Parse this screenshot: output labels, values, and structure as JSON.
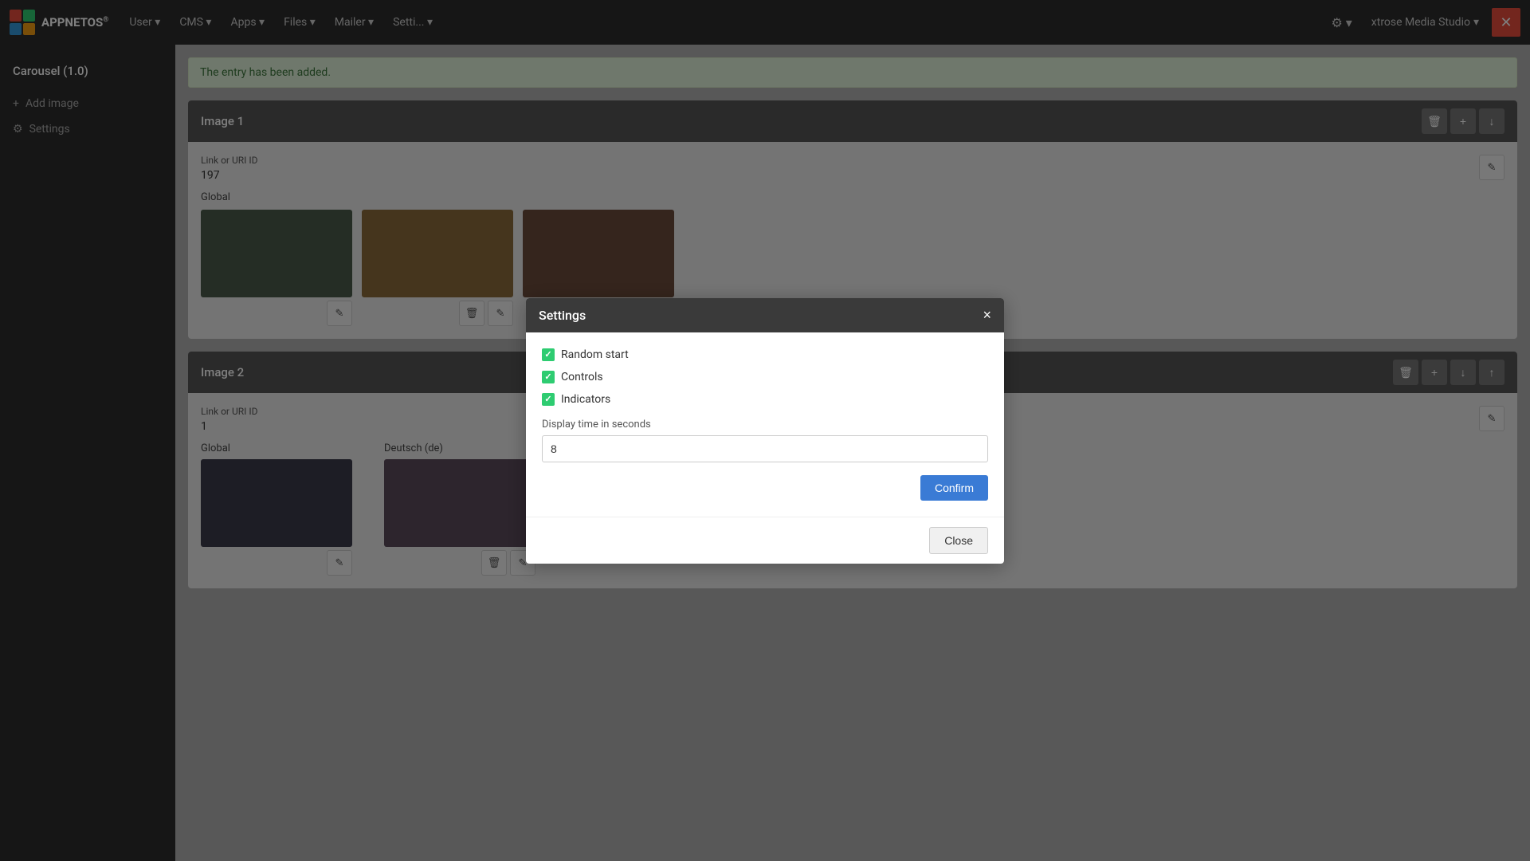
{
  "navbar": {
    "brand": "APPNETOS",
    "brand_sup": "®",
    "nav_items": [
      {
        "label": "User",
        "id": "user"
      },
      {
        "label": "CMS",
        "id": "cms"
      },
      {
        "label": "Apps",
        "id": "apps"
      },
      {
        "label": "Files",
        "id": "files"
      },
      {
        "label": "Mailer",
        "id": "mailer"
      },
      {
        "label": "Setti...",
        "id": "settings"
      }
    ],
    "gear_label": "⚙",
    "studio_label": "xtrose Media Studio",
    "close_icon": "✕"
  },
  "sidebar": {
    "title": "Carousel (1.0)",
    "items": [
      {
        "label": "Add image",
        "icon": "+",
        "id": "add-image"
      },
      {
        "label": "Settings",
        "icon": "⚙",
        "id": "settings"
      }
    ]
  },
  "main": {
    "alert": "The entry has been added.",
    "image1": {
      "title": "Image 1",
      "link_label": "Link or URI ID",
      "link_value": "197",
      "global_label": "Global",
      "images": [
        {
          "id": "img1-global",
          "style": "dark1"
        },
        {
          "id": "img1-2",
          "style": "dark2"
        },
        {
          "id": "img1-3",
          "style": "dark3"
        }
      ]
    },
    "image2": {
      "title": "Image 2",
      "link_label": "Link or URI ID",
      "link_value": "1",
      "global_label": "Global",
      "deutsch_label": "Deutsch (de)",
      "images": [
        {
          "id": "img2-global",
          "style": "dark4"
        },
        {
          "id": "img2-de",
          "style": "dark5"
        }
      ]
    }
  },
  "modal": {
    "title": "Settings",
    "close_icon": "×",
    "checkboxes": [
      {
        "label": "Random start",
        "checked": true
      },
      {
        "label": "Controls",
        "checked": true
      },
      {
        "label": "Indicators",
        "checked": true
      }
    ],
    "display_time_label": "Display time in seconds",
    "display_time_value": "8",
    "confirm_label": "Confirm",
    "close_label": "Close"
  }
}
